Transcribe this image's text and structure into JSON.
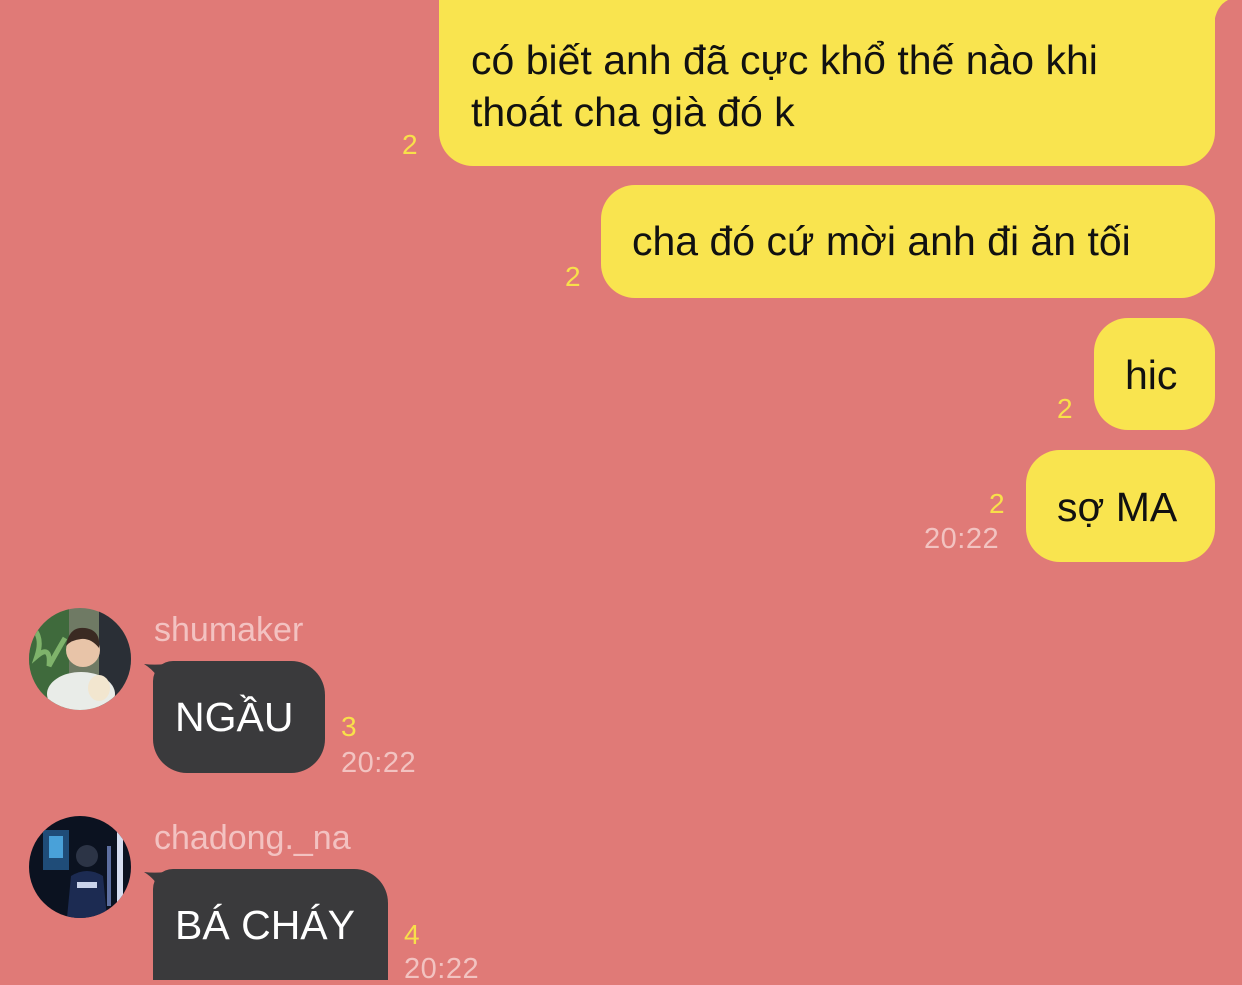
{
  "messages": {
    "m1": {
      "text_line1": "có biết anh đã cực khổ thế nào khi",
      "text_line2": "thoát cha già đó k",
      "read_count": "2"
    },
    "m2": {
      "text": "cha đó cứ mời anh đi ăn tối",
      "read_count": "2"
    },
    "m3": {
      "text": "hic",
      "read_count": "2"
    },
    "m4": {
      "text": "sợ MA",
      "read_count": "2",
      "time": "20:22"
    },
    "m5": {
      "sender": "shumaker",
      "text": "NGẦU",
      "read_count": "3",
      "time": "20:22"
    },
    "m6": {
      "sender": "chadong._na",
      "text": "BÁ CHÁY",
      "read_count": "4",
      "time": "20:22"
    }
  },
  "colors": {
    "background": "#e07a77",
    "my_bubble": "#f9e44f",
    "their_bubble": "#3a3a3c",
    "read_count": "#f8e04a",
    "timestamp": "#f2c3c1"
  },
  "icons": {
    "avatar_1": "avatar-shumaker-photo",
    "avatar_2": "avatar-chadong-photo"
  }
}
